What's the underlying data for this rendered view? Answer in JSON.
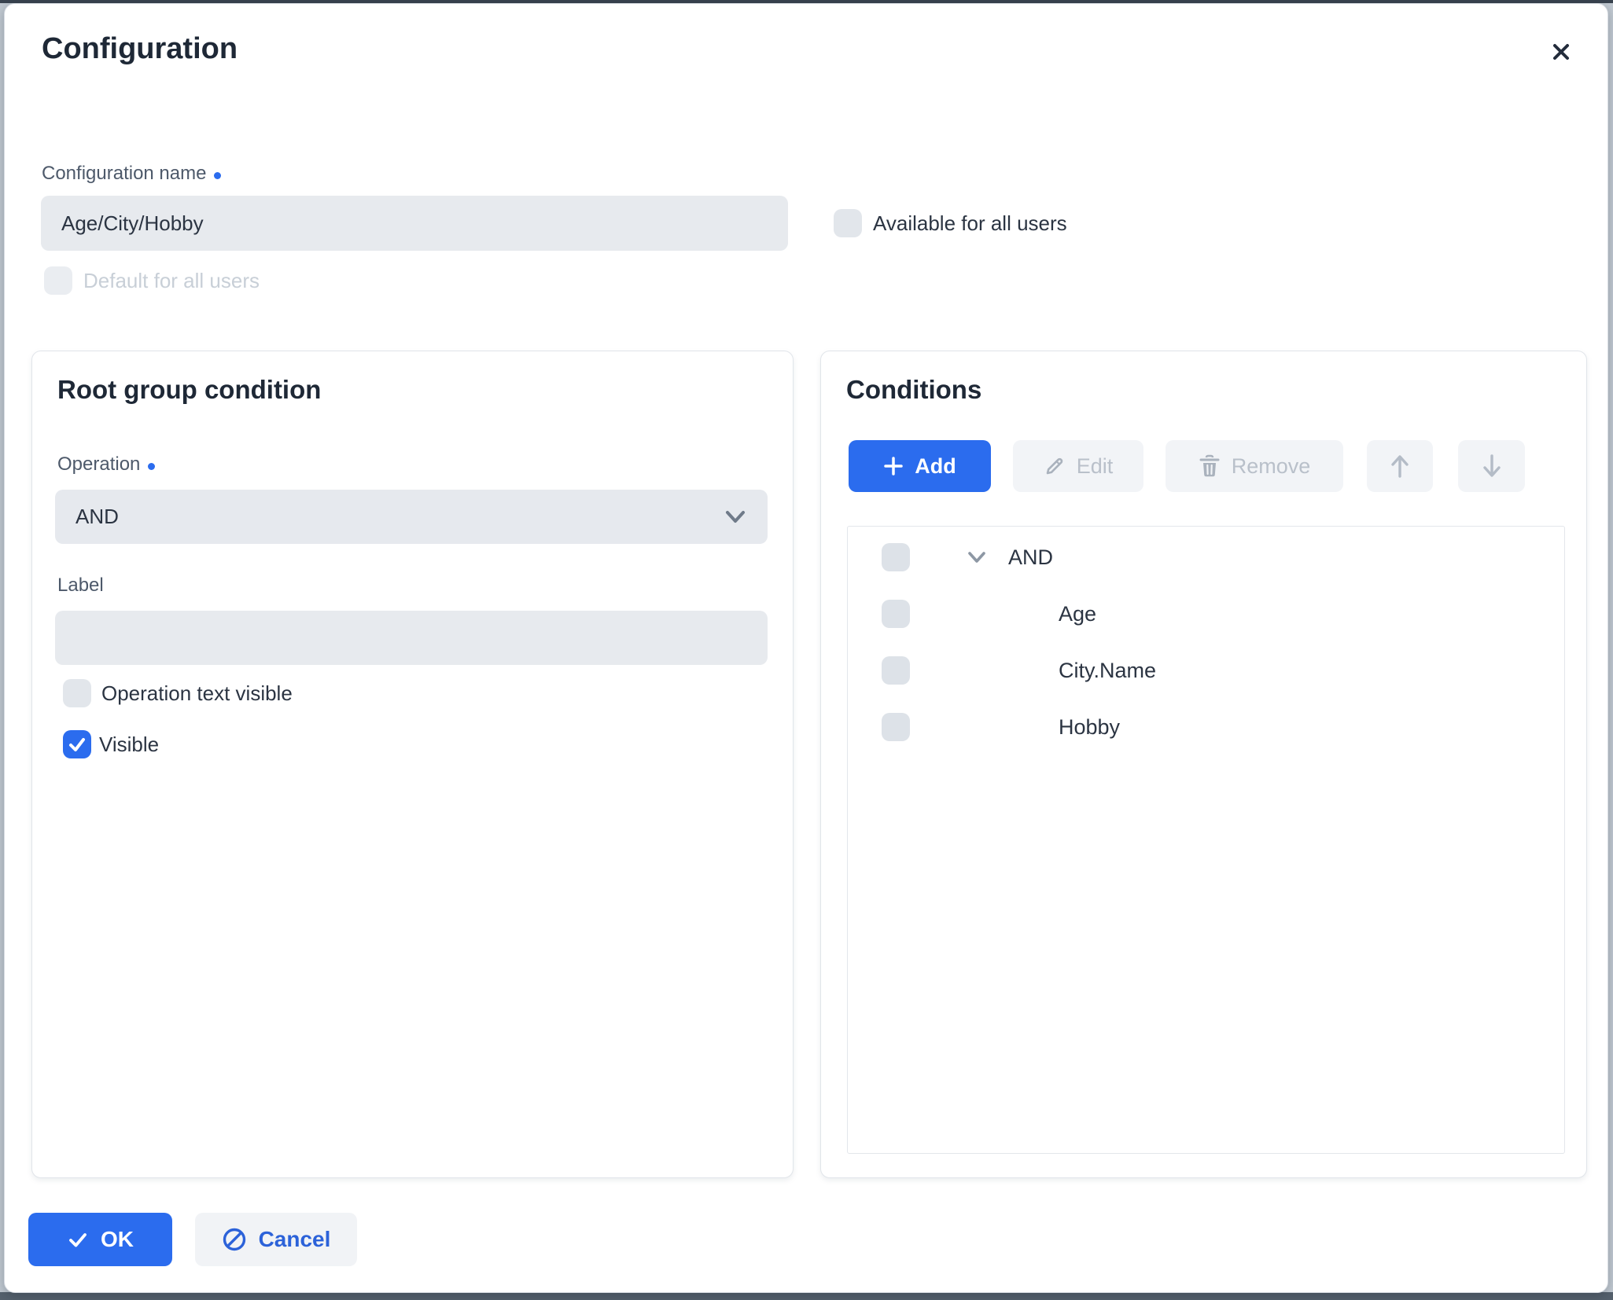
{
  "dialog": {
    "title": "Configuration"
  },
  "name_field": {
    "label": "Configuration name",
    "required": true,
    "value": "Age/City/Hobby"
  },
  "available_checkbox": {
    "label": "Available for all users",
    "checked": false
  },
  "default_checkbox": {
    "label": "Default for all users",
    "checked": false,
    "disabled": true
  },
  "root_group": {
    "title": "Root group condition",
    "operation_label": "Operation",
    "operation_required": true,
    "operation_value": "AND",
    "label_label": "Label",
    "label_value": "",
    "operation_text_visible": {
      "label": "Operation text visible",
      "checked": false
    },
    "visible": {
      "label": "Visible",
      "checked": true
    }
  },
  "conditions": {
    "title": "Conditions",
    "toolbar": {
      "add_label": "Add",
      "edit_label": "Edit",
      "remove_label": "Remove",
      "edit_enabled": false,
      "remove_enabled": false,
      "move_up_enabled": false,
      "move_down_enabled": false
    },
    "tree": {
      "root": "AND",
      "root_expanded": true,
      "children": [
        "Age",
        "City.Name",
        "Hobby"
      ]
    }
  },
  "footer": {
    "ok_label": "OK",
    "cancel_label": "Cancel"
  },
  "icons": {
    "close": "x-mark",
    "add": "plus",
    "edit": "pencil",
    "remove": "trash",
    "move_up": "arrow-up",
    "move_down": "arrow-down",
    "ok": "check",
    "cancel": "slash-circle",
    "tree_collapse": "chevron-down",
    "select_open": "chevron-down"
  },
  "colors": {
    "accent_blue": "#2b6cee",
    "cancel_blue": "#2c62d9",
    "title_text": "#1e2836",
    "body_text": "#2b3442",
    "muted_label": "#4d596a",
    "disabled_text": "#c8cfd7",
    "input_bg": "#e7eaee",
    "disabled_btn_bg": "#f2f4f7",
    "disabled_btn_text": "#b9c0ca",
    "card_border": "#e1e5ea",
    "backdrop": "#55616d"
  }
}
